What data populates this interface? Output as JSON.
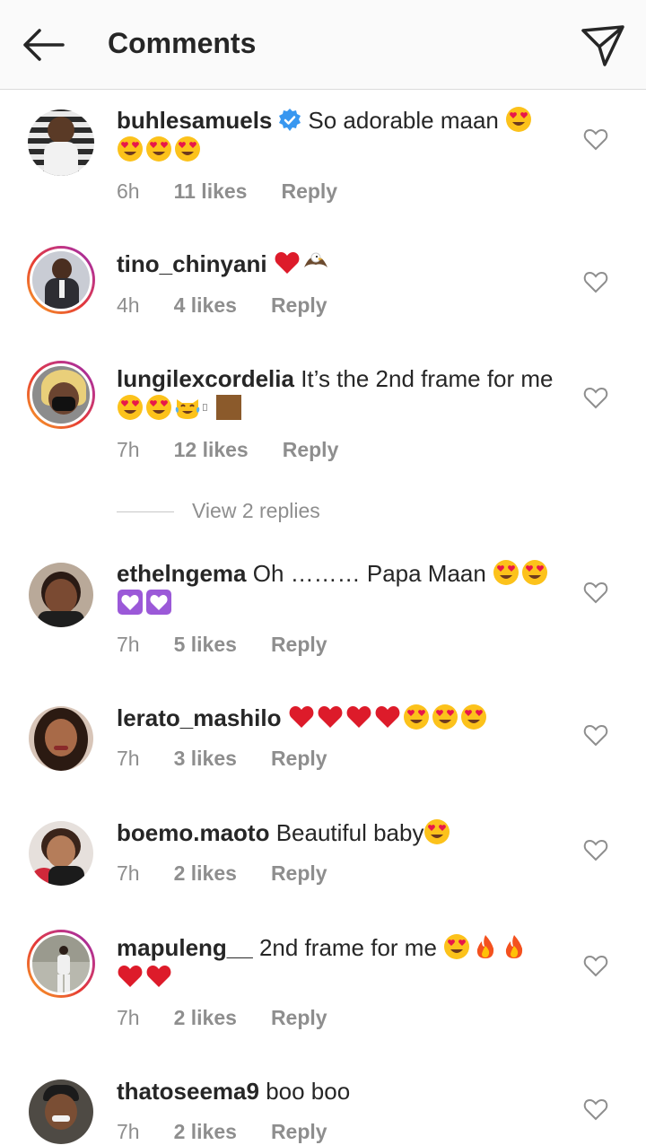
{
  "header": {
    "title": "Comments",
    "back_icon": "arrow-left-icon",
    "share_icon": "paper-plane-icon"
  },
  "colors": {
    "text": "#262626",
    "meta": "#8e8e8e",
    "verified": "#3897f0",
    "heart_red": "#e02020"
  },
  "comments": [
    {
      "username": "buhlesamuels",
      "verified": true,
      "text": "So adorable maan",
      "emojis": [
        "heart-eyes",
        "heart-eyes",
        "heart-eyes",
        "heart-eyes"
      ],
      "time": "6h",
      "likes": "11 likes",
      "reply": "Reply"
    },
    {
      "username": "tino_chinyani",
      "verified": false,
      "text": "",
      "emojis": [
        "red-heart",
        "eagle"
      ],
      "time": "4h",
      "likes": "4 likes",
      "reply": "Reply"
    },
    {
      "username": "lungilexcordelia",
      "verified": false,
      "text": "It’s the 2nd frame for me",
      "emojis": [
        "heart-eyes",
        "heart-eyes",
        "cat-tears-of-joy",
        "missing-glyph",
        "brown-square"
      ],
      "time": "7h",
      "likes": "12 likes",
      "reply": "Reply"
    },
    {
      "username": "ethelngema",
      "verified": false,
      "text": "Oh ……… Papa Maan",
      "emojis": [
        "heart-eyes",
        "heart-eyes",
        "purple-heart",
        "purple-heart"
      ],
      "time": "7h",
      "likes": "5 likes",
      "reply": "Reply"
    },
    {
      "username": "lerato_mashilo",
      "verified": false,
      "text": "",
      "emojis": [
        "red-heart",
        "red-heart",
        "red-heart",
        "red-heart",
        "heart-eyes",
        "heart-eyes",
        "heart-eyes"
      ],
      "time": "7h",
      "likes": "3 likes",
      "reply": "Reply"
    },
    {
      "username": "boemo.maoto",
      "verified": false,
      "text": "Beautiful baby",
      "emojis": [
        "heart-eyes"
      ],
      "time": "7h",
      "likes": "2 likes",
      "reply": "Reply"
    },
    {
      "username": "mapuleng__",
      "verified": false,
      "text": "2nd frame for me",
      "emojis": [
        "heart-eyes",
        "fire",
        "fire",
        "red-heart",
        "red-heart"
      ],
      "time": "7h",
      "likes": "2 likes",
      "reply": "Reply"
    },
    {
      "username": "thatoseema9",
      "verified": false,
      "text": "boo boo",
      "emojis": [],
      "time": "7h",
      "likes": "2 likes",
      "reply": "Reply"
    }
  ],
  "view_replies": "View 2 replies"
}
